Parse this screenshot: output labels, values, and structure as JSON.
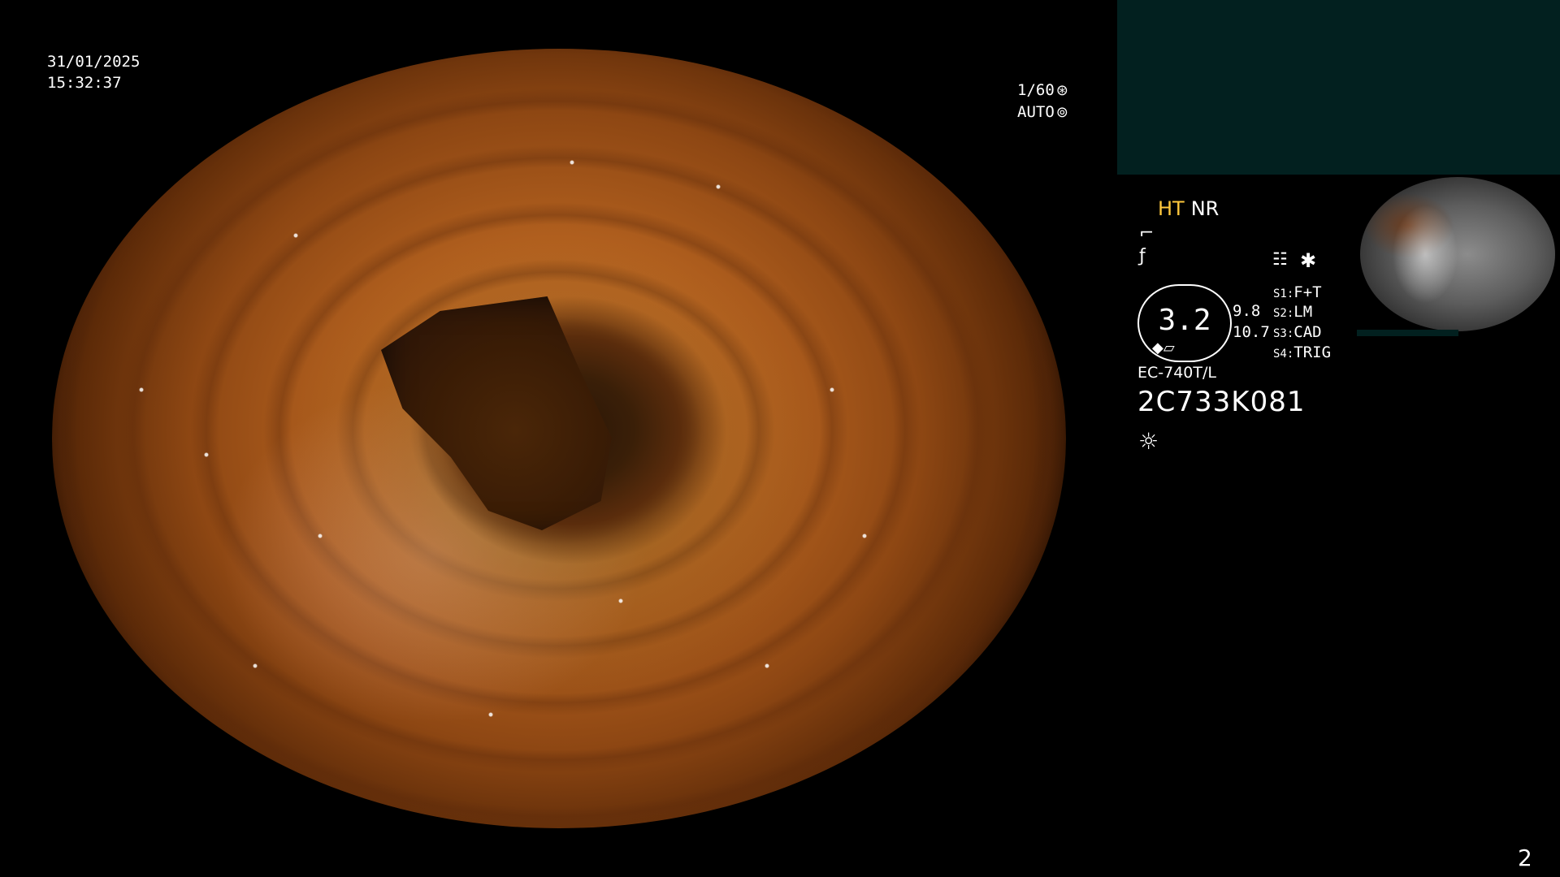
{
  "overlay": {
    "date": "31/01/2025",
    "time": "15:32:37",
    "shutter": "1/60",
    "shutter_icon": "⊛",
    "iris": "AUTO",
    "iris_icon": "⊚"
  },
  "panel": {
    "ht_label": "HT",
    "nr_label": "NR",
    "icon_1": "⌐",
    "icon_2": "ƒ",
    "menu_icon": "☷",
    "asterisk": "✱",
    "zoom_value": "3.2",
    "zoom_glyph": "◆▱",
    "scale_a": "9.8",
    "scale_b": "10.7",
    "switches": [
      {
        "key": "S1:",
        "label": "F+T"
      },
      {
        "key": "S2:",
        "label": "LM"
      },
      {
        "key": "S3:",
        "label": "CAD"
      },
      {
        "key": "S4:",
        "label": "TRIG"
      }
    ],
    "scope_model": "EC-740T/L",
    "scope_serial": "2C733K081",
    "light_icon": "☼"
  },
  "footer": {
    "page_number": "2"
  },
  "colors": {
    "ht_color": "#ffc83d",
    "panel_bg": "#02201f"
  }
}
